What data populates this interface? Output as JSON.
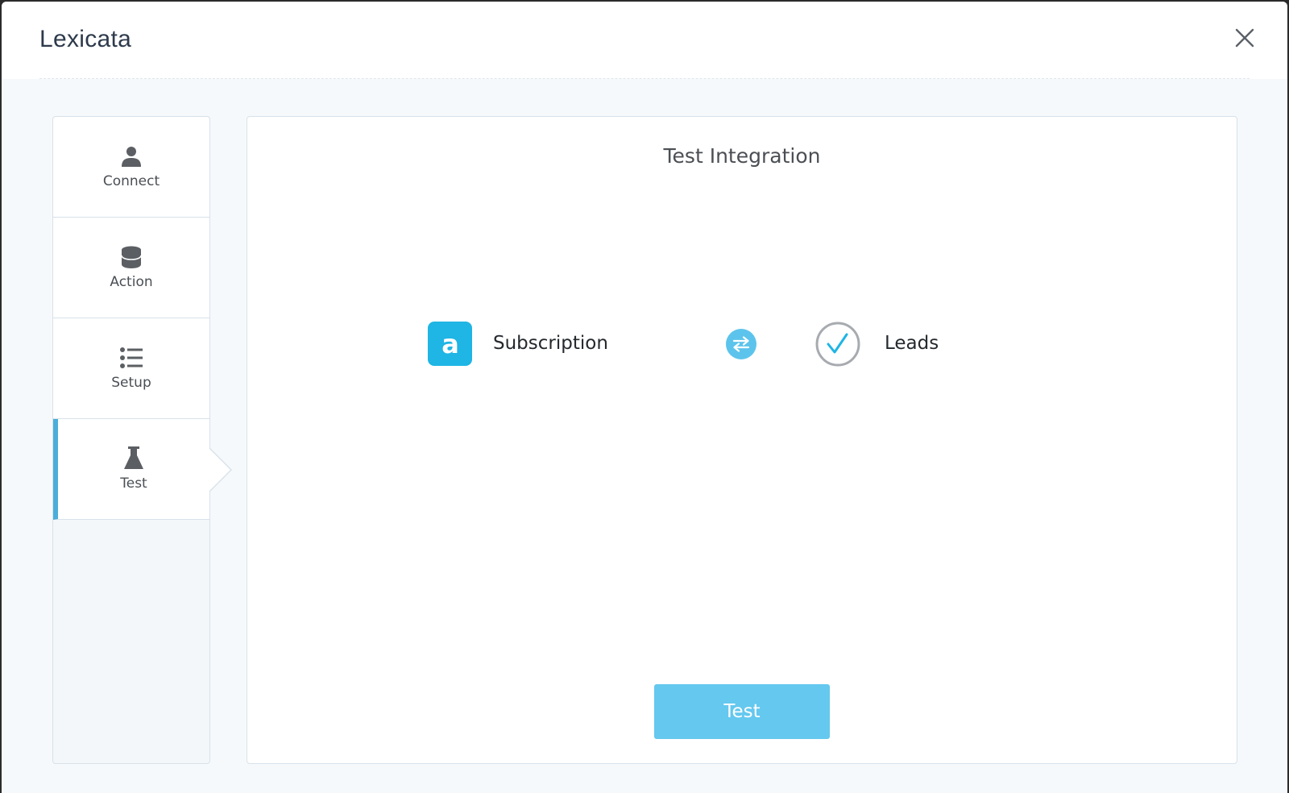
{
  "modal": {
    "title": "Lexicata"
  },
  "sidebar": {
    "steps": [
      {
        "label": "Connect",
        "icon": "user-icon"
      },
      {
        "label": "Action",
        "icon": "database-icon"
      },
      {
        "label": "Setup",
        "icon": "list-icon"
      },
      {
        "label": "Test",
        "icon": "flask-icon",
        "active": true
      }
    ]
  },
  "panel": {
    "title": "Test Integration",
    "source": {
      "label": "Subscription",
      "logo_letter": "a",
      "logo_color": "#1fb5e4"
    },
    "target": {
      "label": "Leads"
    },
    "test_button_label": "Test"
  },
  "colors": {
    "accent": "#4aaed9",
    "button": "#64c8ef",
    "swap": "#5cc4ec"
  }
}
